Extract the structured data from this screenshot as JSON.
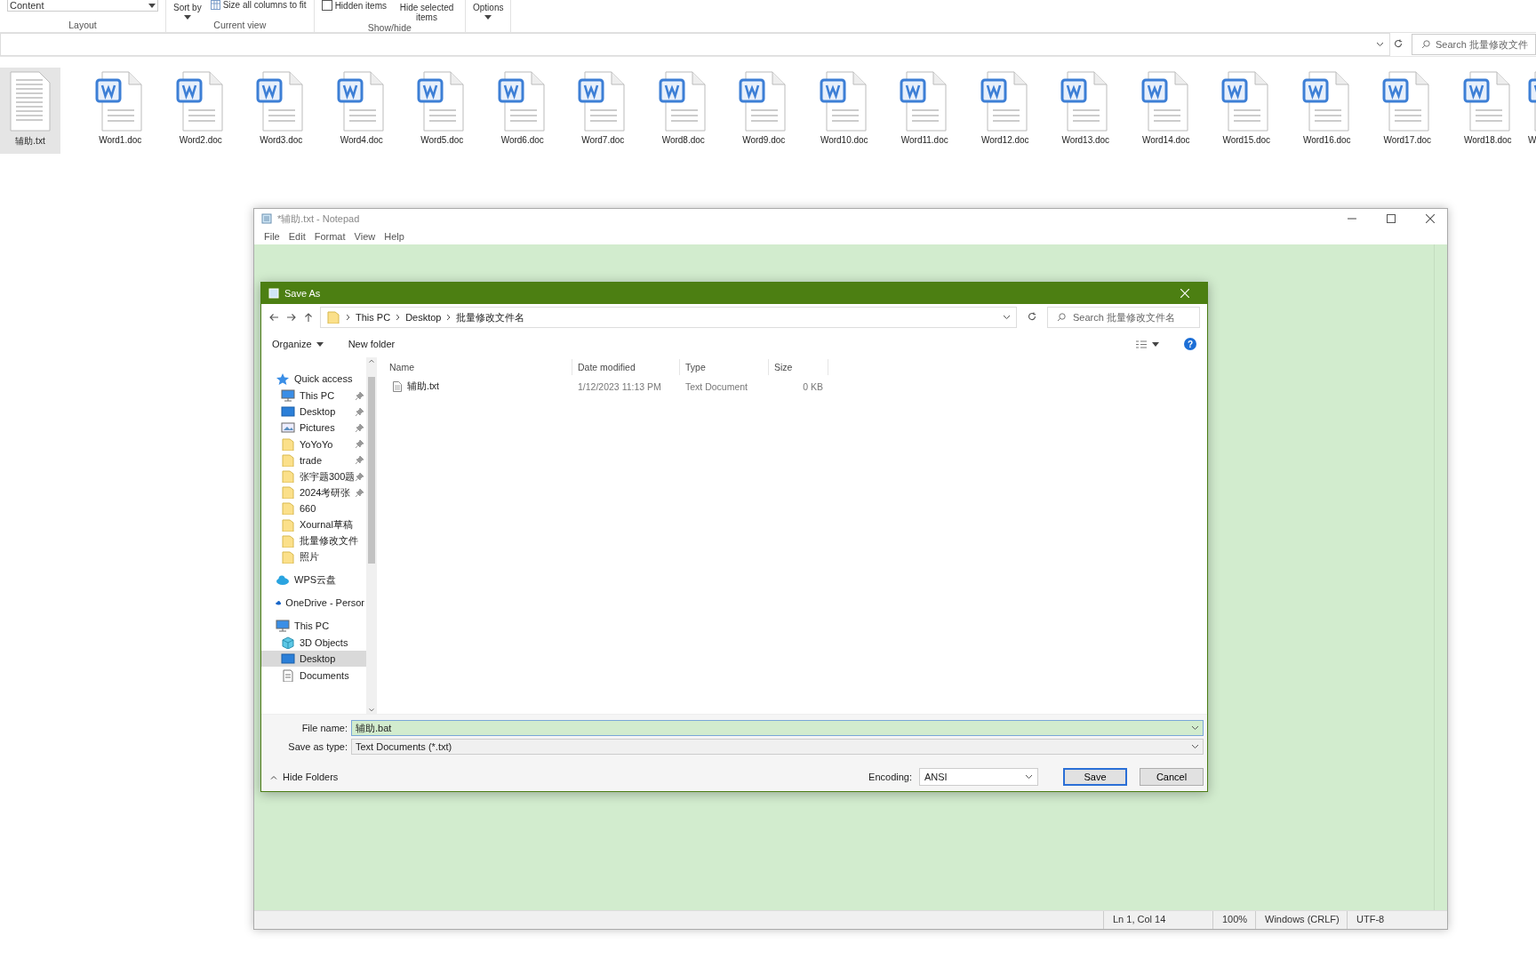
{
  "explorer": {
    "ribbon": [
      {
        "label": "Layout",
        "items": [
          {
            "kind": "dropdown",
            "label": "Content"
          }
        ]
      },
      {
        "label": "Current view",
        "items": [
          {
            "kind": "menu",
            "label": "Sort by"
          },
          {
            "kind": "button",
            "label": "Size all columns to fit"
          }
        ]
      },
      {
        "label": "Show/hide",
        "items": [
          {
            "kind": "checkbox",
            "label": "Hidden items",
            "checked": false
          },
          {
            "kind": "button",
            "label": "Hide selected items"
          }
        ]
      },
      {
        "items": [
          {
            "kind": "menu",
            "label": "Options"
          }
        ]
      }
    ],
    "search": {
      "placeholder": "Search 批量修改文件"
    },
    "files": [
      {
        "name": "辅助.txt",
        "kind": "txt",
        "selected": true
      },
      {
        "name": "Word1.doc",
        "kind": "doc",
        "selected": false
      },
      {
        "name": "Word2.doc",
        "kind": "doc",
        "selected": false
      },
      {
        "name": "Word3.doc",
        "kind": "doc",
        "selected": false
      },
      {
        "name": "Word4.doc",
        "kind": "doc",
        "selected": false
      },
      {
        "name": "Word5.doc",
        "kind": "doc",
        "selected": false
      },
      {
        "name": "Word6.doc",
        "kind": "doc",
        "selected": false
      },
      {
        "name": "Word7.doc",
        "kind": "doc",
        "selected": false
      },
      {
        "name": "Word8.doc",
        "kind": "doc",
        "selected": false
      },
      {
        "name": "Word9.doc",
        "kind": "doc",
        "selected": false
      },
      {
        "name": "Word10.doc",
        "kind": "doc",
        "selected": false
      },
      {
        "name": "Word11.doc",
        "kind": "doc",
        "selected": false
      },
      {
        "name": "Word12.doc",
        "kind": "doc",
        "selected": false
      },
      {
        "name": "Word13.doc",
        "kind": "doc",
        "selected": false
      },
      {
        "name": "Word14.doc",
        "kind": "doc",
        "selected": false
      },
      {
        "name": "Word15.doc",
        "kind": "doc",
        "selected": false
      },
      {
        "name": "Word16.doc",
        "kind": "doc",
        "selected": false
      },
      {
        "name": "Word17.doc",
        "kind": "doc",
        "selected": false
      },
      {
        "name": "Word18.doc",
        "kind": "doc",
        "selected": false
      },
      {
        "name": "W",
        "kind": "doc",
        "selected": false
      }
    ]
  },
  "notepad": {
    "title": "*辅助.txt - Notepad",
    "menu": [
      "File",
      "Edit",
      "Format",
      "View",
      "Help"
    ],
    "status_bar": [
      "Ln 1, Col 14",
      "100%",
      "Windows (CRLF)",
      "UTF-8"
    ]
  },
  "save_as": {
    "title": "Save As",
    "breadcrumb": [
      "This PC",
      "Desktop",
      "批量修改文件名"
    ],
    "search": {
      "placeholder": "Search 批量修改文件名"
    },
    "toolbar": [
      {
        "kind": "menu",
        "label": "Organize"
      },
      {
        "kind": "button",
        "label": "New folder"
      }
    ],
    "help": "?",
    "nav": [
      {
        "label": "Quick access",
        "kind": "star",
        "selected": false,
        "children": [
          {
            "label": "This PC",
            "kind": "pc",
            "pinned": true,
            "selected": false
          },
          {
            "label": "Desktop",
            "kind": "desktop",
            "pinned": true,
            "selected": false
          },
          {
            "label": "Pictures",
            "kind": "pictures",
            "pinned": true,
            "selected": false
          },
          {
            "label": "YoYoYo",
            "kind": "folder",
            "pinned": true,
            "selected": false
          },
          {
            "label": "trade",
            "kind": "folder",
            "pinned": true,
            "selected": false
          },
          {
            "label": "张宇题300题",
            "kind": "folder",
            "pinned": true,
            "selected": false
          },
          {
            "label": "2024考研张",
            "kind": "folder",
            "pinned": true,
            "selected": false
          },
          {
            "label": "660",
            "kind": "folder",
            "pinned": false,
            "selected": false
          },
          {
            "label": "Xournal草稿",
            "kind": "folder",
            "pinned": false,
            "selected": false
          },
          {
            "label": "批量修改文件",
            "kind": "folder",
            "pinned": false,
            "selected": false
          },
          {
            "label": "照片",
            "kind": "folder",
            "pinned": false,
            "selected": false
          }
        ]
      },
      {
        "label": "WPS云盘",
        "kind": "cloud",
        "selected": false
      },
      {
        "label": "OneDrive - Persor",
        "kind": "onedrive",
        "selected": false
      },
      {
        "label": "This PC",
        "kind": "pc",
        "selected": false,
        "children": [
          {
            "label": "3D Objects",
            "kind": "objects",
            "pinned": false,
            "selected": false
          },
          {
            "label": "Desktop",
            "kind": "desktop",
            "pinned": false,
            "selected": true
          },
          {
            "label": "Documents",
            "kind": "documents",
            "pinned": false,
            "selected": false
          }
        ]
      }
    ],
    "columns": [
      "Name",
      "Date modified",
      "Type",
      "Size"
    ],
    "rows": [
      {
        "cells": [
          "辅助.txt",
          "1/12/2023 11:13 PM",
          "Text Document",
          "0 KB"
        ]
      }
    ],
    "file_name": {
      "label": "File name:",
      "value": "辅助.bat"
    },
    "save_as_type": {
      "label": "Save as type:",
      "value": "Text Documents (*.txt)"
    },
    "hide_folders": "Hide Folders",
    "encoding": {
      "label": "Encoding:",
      "value": "ANSI"
    },
    "buttons": [
      {
        "kind": "default",
        "label": "Save"
      },
      {
        "kind": "normal",
        "label": "Cancel"
      }
    ]
  }
}
